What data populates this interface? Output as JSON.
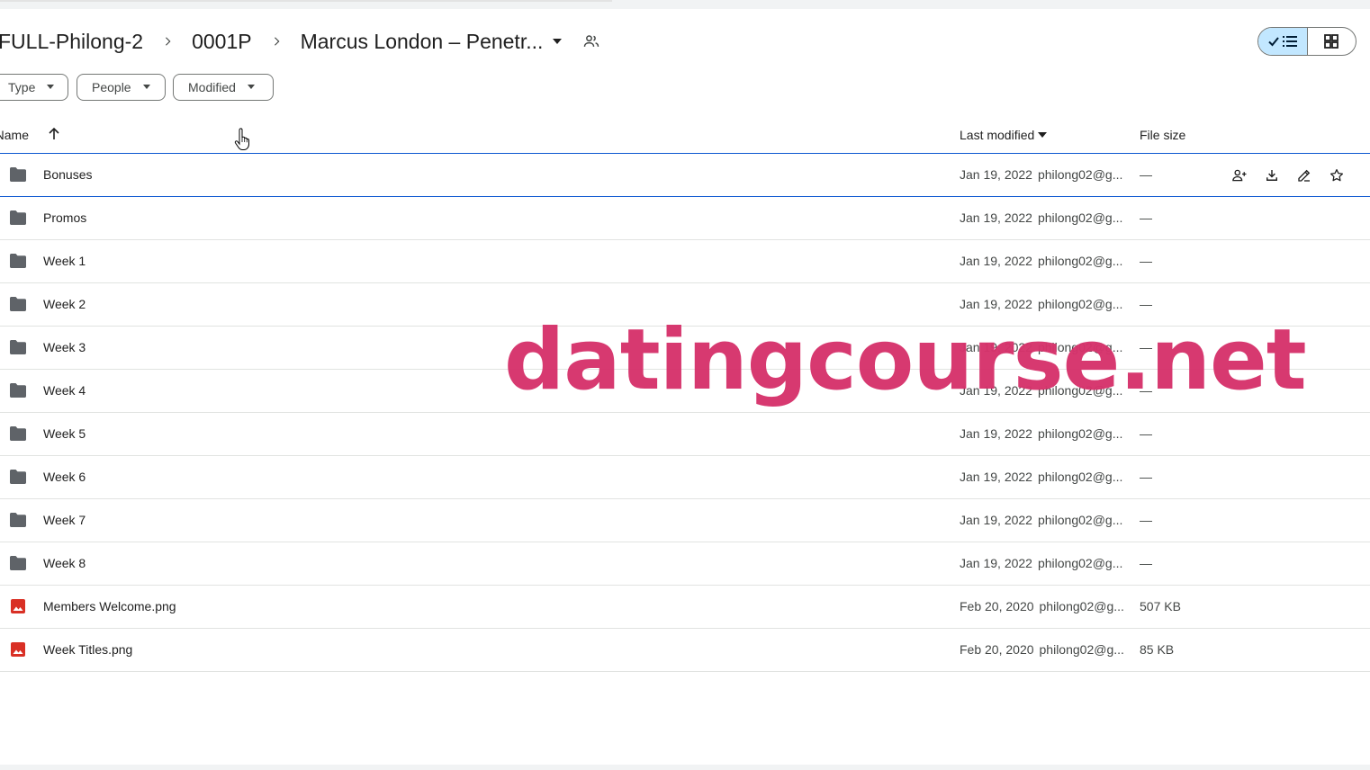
{
  "breadcrumb": {
    "items": [
      "FULL-Philong-2",
      "0001P"
    ],
    "current": "Marcus London – Penetr..."
  },
  "filters": {
    "type_label": "Type",
    "people_label": "People",
    "modified_label": "Modified"
  },
  "columns": {
    "name": "Name",
    "last_modified": "Last modified",
    "file_size": "File size"
  },
  "files": [
    {
      "name": "Bonuses",
      "kind": "folder",
      "date": "Jan 19, 2022",
      "owner": "philong02@g...",
      "size": "—"
    },
    {
      "name": "Promos",
      "kind": "folder",
      "date": "Jan 19, 2022",
      "owner": "philong02@g...",
      "size": "—"
    },
    {
      "name": "Week 1",
      "kind": "folder",
      "date": "Jan 19, 2022",
      "owner": "philong02@g...",
      "size": "—"
    },
    {
      "name": "Week 2",
      "kind": "folder",
      "date": "Jan 19, 2022",
      "owner": "philong02@g...",
      "size": "—"
    },
    {
      "name": "Week 3",
      "kind": "folder",
      "date": "Jan 19, 2022",
      "owner": "philong02@g...",
      "size": "—"
    },
    {
      "name": "Week 4",
      "kind": "folder",
      "date": "Jan 19, 2022",
      "owner": "philong02@g...",
      "size": "—"
    },
    {
      "name": "Week 5",
      "kind": "folder",
      "date": "Jan 19, 2022",
      "owner": "philong02@g...",
      "size": "—"
    },
    {
      "name": "Week 6",
      "kind": "folder",
      "date": "Jan 19, 2022",
      "owner": "philong02@g...",
      "size": "—"
    },
    {
      "name": "Week 7",
      "kind": "folder",
      "date": "Jan 19, 2022",
      "owner": "philong02@g...",
      "size": "—"
    },
    {
      "name": "Week 8",
      "kind": "folder",
      "date": "Jan 19, 2022",
      "owner": "philong02@g...",
      "size": "—"
    },
    {
      "name": "Members Welcome.png",
      "kind": "image",
      "date": "Feb 20, 2020",
      "owner": "philong02@g...",
      "size": "507 KB"
    },
    {
      "name": "Week Titles.png",
      "kind": "image",
      "date": "Feb 20, 2020",
      "owner": "philong02@g...",
      "size": "85 KB"
    }
  ],
  "row_actions": [
    "add-person-icon",
    "download-icon",
    "rename-icon",
    "star-icon"
  ],
  "view_modes": [
    "list-view-icon",
    "grid-view-icon"
  ],
  "watermark": "datingcourse.net",
  "colors": {
    "accent": "#0b57d0",
    "toggle_active": "#c2e7ff",
    "folder": "#5f6368",
    "image_file": "#d93025",
    "watermark": "#d6336c"
  }
}
